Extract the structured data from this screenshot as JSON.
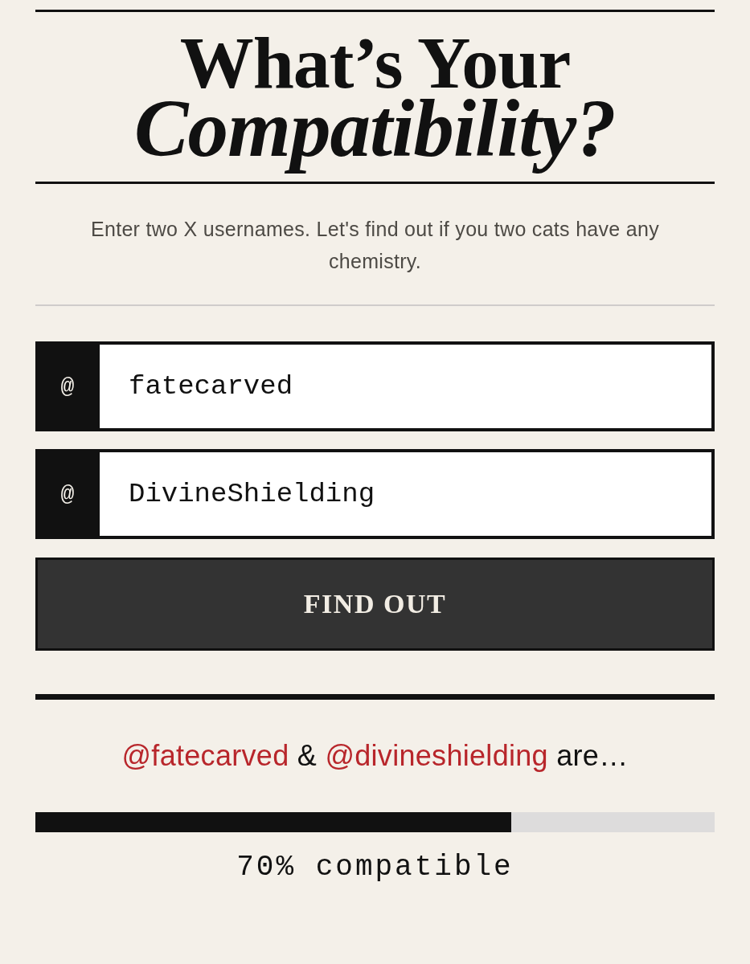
{
  "title": "What’s Your *Compatibility?*",
  "intro": "Enter two X usernames. Let's find out if you two cats have any chemistry.",
  "fields": [
    {
      "prefix": "@",
      "value": "fatecarved"
    },
    {
      "prefix": "@",
      "value": "DivineShielding"
    }
  ],
  "button": "FIND OUT",
  "result": {
    "parts": [
      {
        "text": "@fatecarved",
        "highlight": true
      },
      {
        "text": "&",
        "highlight": false
      },
      {
        "text": "@divineshielding",
        "highlight": true
      },
      {
        "text": "are…",
        "highlight": false
      }
    ],
    "level": 0.7,
    "reading": "70% compatible"
  }
}
